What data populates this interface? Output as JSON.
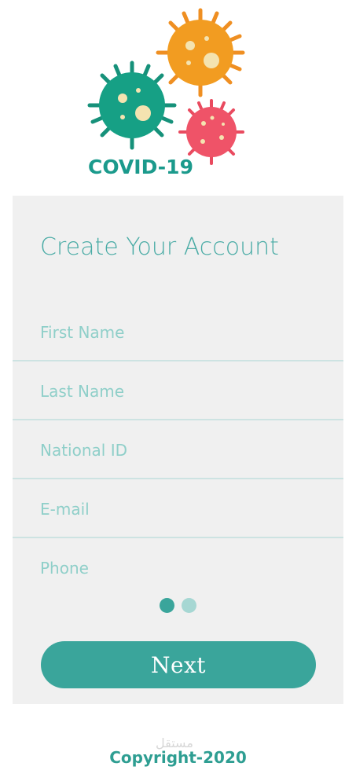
{
  "brand": {
    "name": "COVID-19",
    "logo_icon": "virus-icon"
  },
  "form": {
    "title": "Create Your Account",
    "fields": [
      {
        "placeholder": "First Name",
        "value": ""
      },
      {
        "placeholder": "Last Name",
        "value": ""
      },
      {
        "placeholder": "National ID",
        "value": ""
      },
      {
        "placeholder": "E-mail",
        "value": ""
      },
      {
        "placeholder": "Phone",
        "value": ""
      }
    ],
    "steps": {
      "current": 1,
      "total": 2
    },
    "next_label": "Next"
  },
  "footer": {
    "copyright": "Copyright-2020",
    "watermark": "مستقل"
  },
  "colors": {
    "accent": "#3aa59b",
    "accent_light": "#a6d7d3",
    "card_bg": "#f0f0f0",
    "virus_orange": "#f29c21",
    "virus_green": "#16a085",
    "virus_red": "#ef5368",
    "virus_spot": "#f4e3b0"
  }
}
